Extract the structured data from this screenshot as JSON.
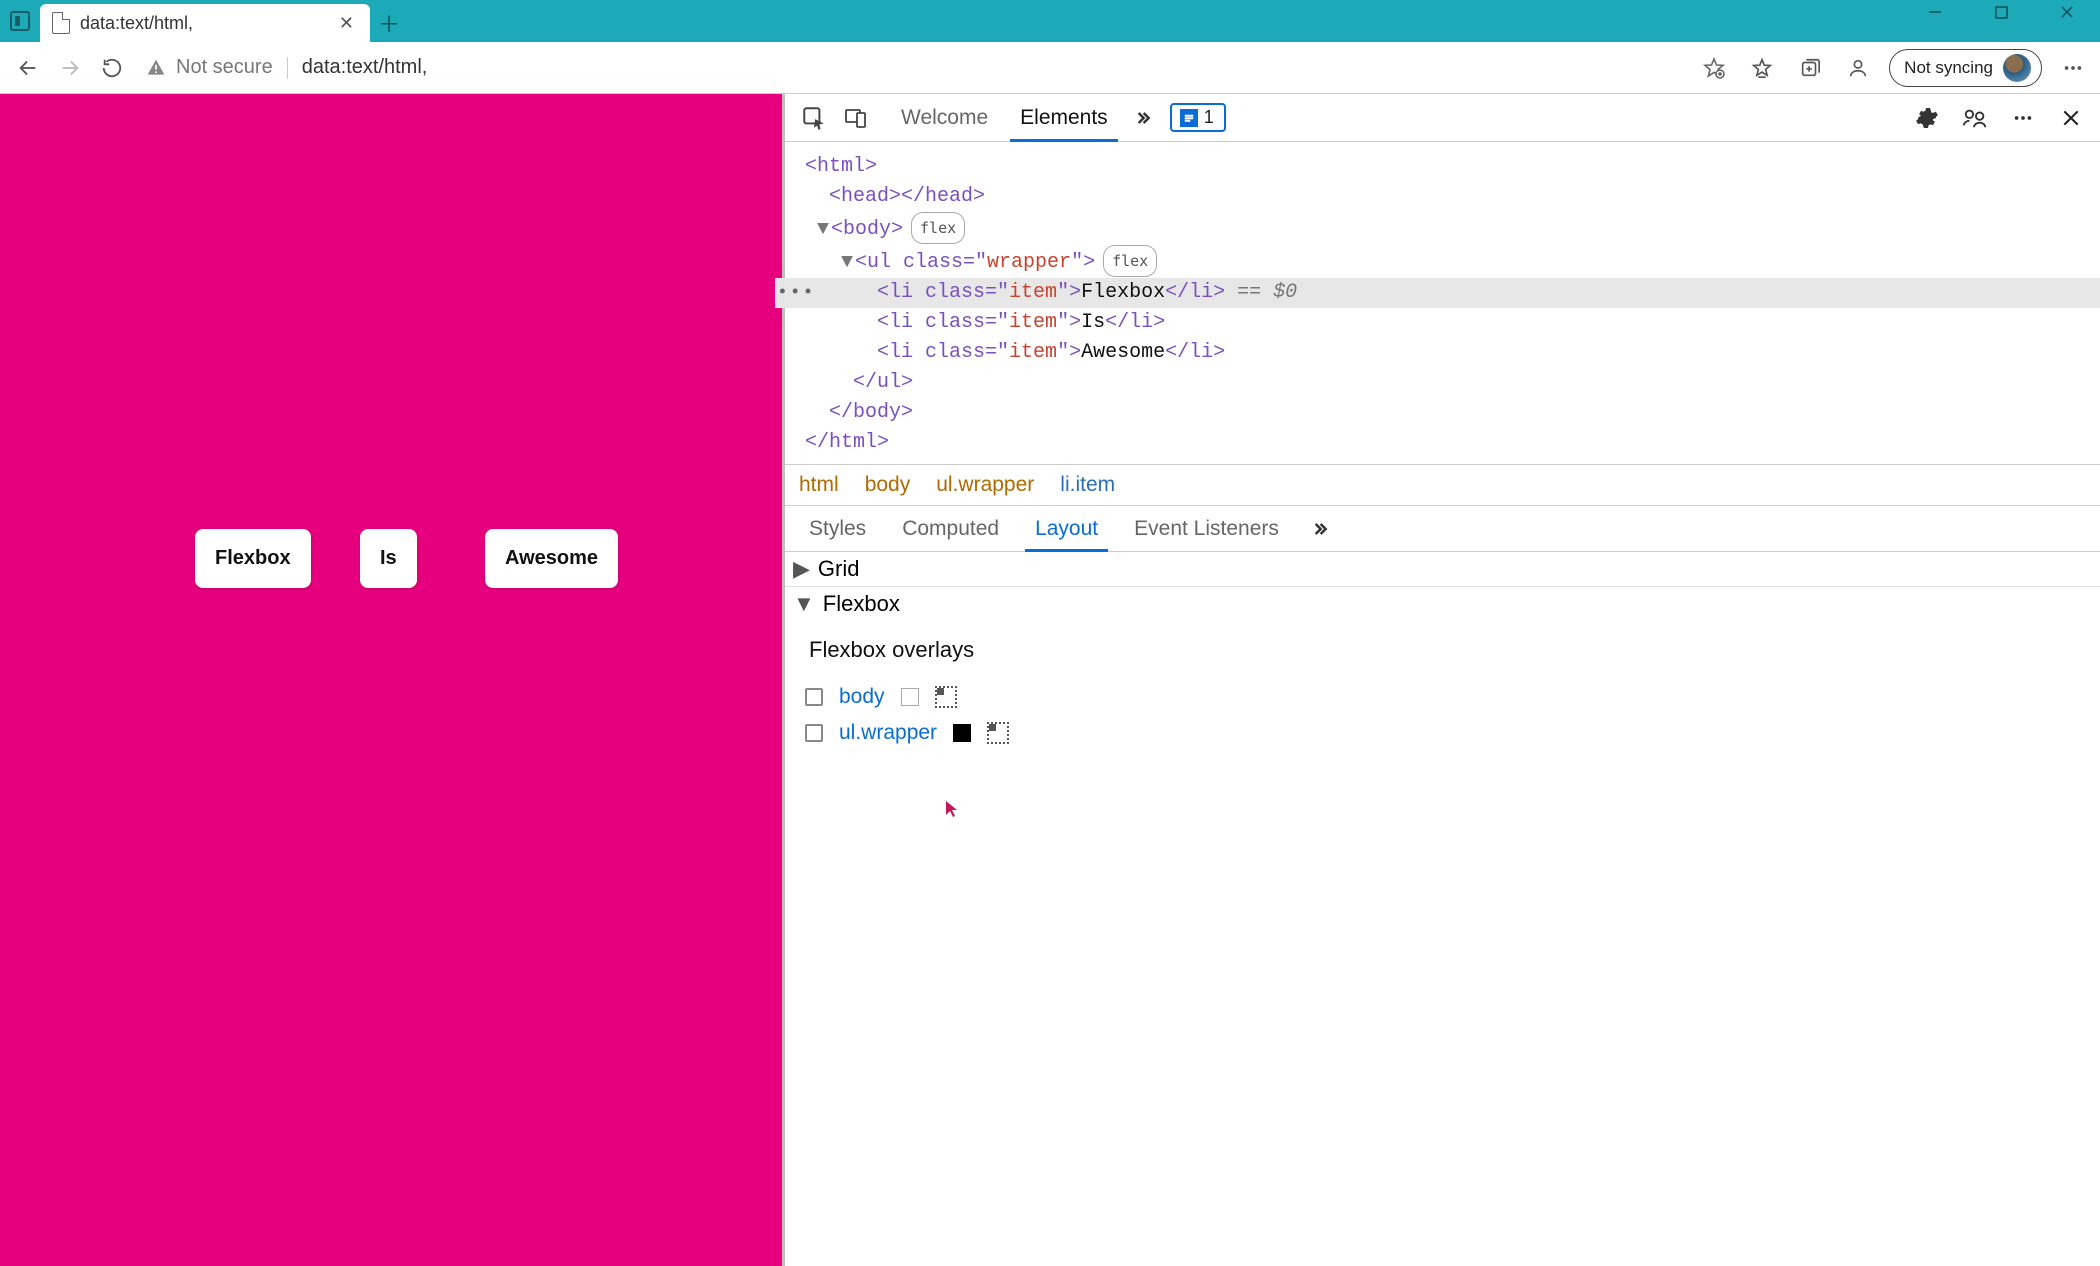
{
  "window": {
    "tab_title": "data:text/html,"
  },
  "address": {
    "security_label": "Not secure",
    "url": "data:text/html,",
    "sync_label": "Not syncing"
  },
  "page": {
    "items": [
      "Flexbox",
      "Is",
      "Awesome"
    ]
  },
  "devtools": {
    "top_tabs": {
      "welcome": "Welcome",
      "elements": "Elements"
    },
    "issues_count": "1",
    "dom": {
      "html_open": "<html>",
      "head": "<head></head>",
      "body_open": "<body>",
      "body_pill": "flex",
      "ul_open_before_val": "<ul class=\"",
      "ul_class_val": "wrapper",
      "ul_open_after_val": "\">",
      "ul_pill": "flex",
      "li_prefix": "<li class=\"",
      "li_class_val": "item",
      "li_mid": "\">",
      "li_close": "</li>",
      "li1_text": "Flexbox",
      "li2_text": "Is",
      "li3_text": "Awesome",
      "sel_suffix": " == $0",
      "ul_close": "</ul>",
      "body_close": "</body>",
      "html_close": "</html>"
    },
    "crumbs": [
      "html",
      "body",
      "ul.wrapper",
      "li.item"
    ],
    "lower_tabs": [
      "Styles",
      "Computed",
      "Layout",
      "Event Listeners"
    ],
    "sections": {
      "grid": "Grid",
      "flexbox": "Flexbox"
    },
    "flexbox_panel": {
      "title": "Flexbox overlays",
      "rows": [
        {
          "label": "body"
        },
        {
          "label": "ul.wrapper"
        }
      ]
    }
  }
}
